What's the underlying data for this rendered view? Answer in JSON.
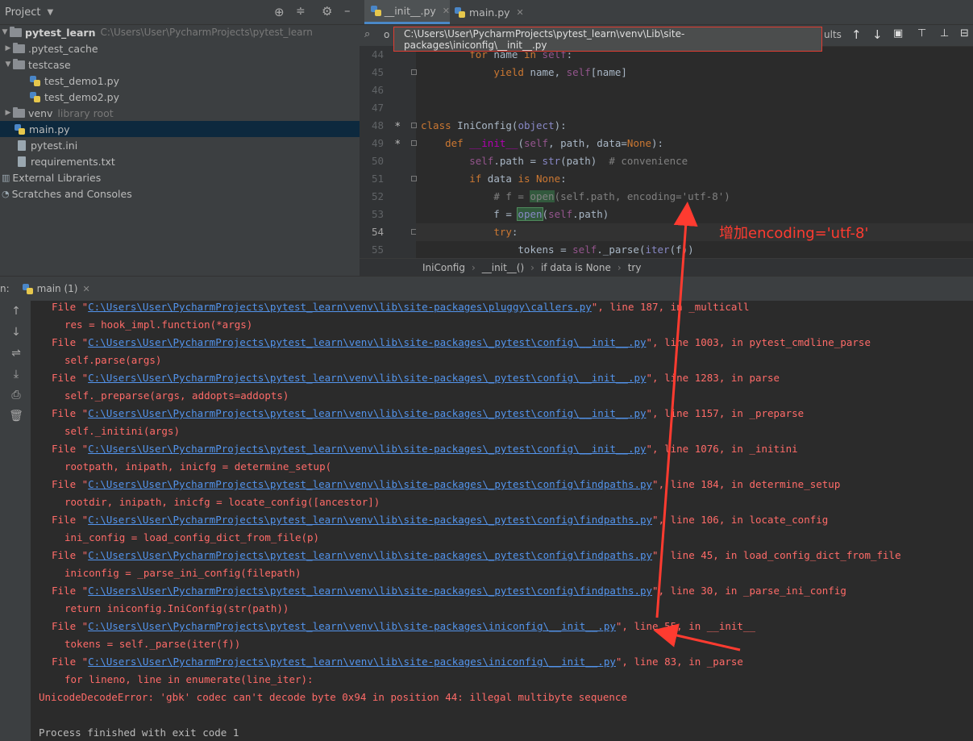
{
  "project": {
    "title": "Project",
    "tree": [
      {
        "label": "pytest_learn",
        "path": "C:\\Users\\User\\PycharmProjects\\pytest_learn"
      },
      {
        "label": ".pytest_cache"
      },
      {
        "label": "testcase"
      },
      {
        "label": "test_demo1.py"
      },
      {
        "label": "test_demo2.py"
      },
      {
        "label": "venv",
        "note": "library root"
      },
      {
        "label": "main.py"
      },
      {
        "label": "pytest.ini"
      },
      {
        "label": "requirements.txt"
      },
      {
        "label": "External Libraries"
      },
      {
        "label": "Scratches and Consoles"
      }
    ]
  },
  "editor": {
    "tabs": [
      {
        "label": "__init__.py"
      },
      {
        "label": "main.py"
      }
    ],
    "find_partial": "o",
    "find_results_partial": "ults",
    "tooltip": "C:\\Users\\User\\PycharmProjects\\pytest_learn\\venv\\Lib\\site-packages\\iniconfig\\__init__.py",
    "line_numbers": [
      "44",
      "45",
      "46",
      "47",
      "48",
      "49",
      "50",
      "51",
      "52",
      "53",
      "54",
      "55"
    ],
    "breadcrumb": [
      "IniConfig",
      "__init__()",
      "if data is None",
      "try"
    ],
    "annotation": "增加encoding='utf-8'"
  },
  "run": {
    "label": "n:",
    "tab": "main (1)",
    "console": [
      {
        "pre": "File \"",
        "link": "C:\\Users\\User\\PycharmProjects\\pytest_learn\\venv\\lib\\site-packages\\pluggy\\callers.py",
        "post": "\", line 187, in _multicall"
      },
      {
        "text": "res = hook_impl.function(*args)"
      },
      {
        "pre": "File \"",
        "link": "C:\\Users\\User\\PycharmProjects\\pytest_learn\\venv\\lib\\site-packages\\_pytest\\config\\__init__.py",
        "post": "\", line 1003, in pytest_cmdline_parse"
      },
      {
        "text": "self.parse(args)"
      },
      {
        "pre": "File \"",
        "link": "C:\\Users\\User\\PycharmProjects\\pytest_learn\\venv\\lib\\site-packages\\_pytest\\config\\__init__.py",
        "post": "\", line 1283, in parse"
      },
      {
        "text": "self._preparse(args, addopts=addopts)"
      },
      {
        "pre": "File \"",
        "link": "C:\\Users\\User\\PycharmProjects\\pytest_learn\\venv\\lib\\site-packages\\_pytest\\config\\__init__.py",
        "post": "\", line 1157, in _preparse"
      },
      {
        "text": "self._initini(args)"
      },
      {
        "pre": "File \"",
        "link": "C:\\Users\\User\\PycharmProjects\\pytest_learn\\venv\\lib\\site-packages\\_pytest\\config\\__init__.py",
        "post": "\", line 1076, in _initini"
      },
      {
        "text": "rootpath, inipath, inicfg = determine_setup("
      },
      {
        "pre": "File \"",
        "link": "C:\\Users\\User\\PycharmProjects\\pytest_learn\\venv\\lib\\site-packages\\_pytest\\config\\findpaths.py",
        "post": "\", line 184, in determine_setup"
      },
      {
        "text": "rootdir, inipath, inicfg = locate_config([ancestor])"
      },
      {
        "pre": "File \"",
        "link": "C:\\Users\\User\\PycharmProjects\\pytest_learn\\venv\\lib\\site-packages\\_pytest\\config\\findpaths.py",
        "post": "\", line 106, in locate_config"
      },
      {
        "text": "ini_config = load_config_dict_from_file(p)"
      },
      {
        "pre": "File \"",
        "link": "C:\\Users\\User\\PycharmProjects\\pytest_learn\\venv\\lib\\site-packages\\_pytest\\config\\findpaths.py",
        "post": "\", line 45, in load_config_dict_from_file"
      },
      {
        "text": "iniconfig = _parse_ini_config(filepath)"
      },
      {
        "pre": "File \"",
        "link": "C:\\Users\\User\\PycharmProjects\\pytest_learn\\venv\\lib\\site-packages\\_pytest\\config\\findpaths.py",
        "post": "\", line 30, in _parse_ini_config"
      },
      {
        "text": "return iniconfig.IniConfig(str(path))"
      },
      {
        "pre": "File \"",
        "link": "C:\\Users\\User\\PycharmProjects\\pytest_learn\\venv\\lib\\site-packages\\iniconfig\\__init__.py",
        "post": "\", line 55, in __init__"
      },
      {
        "text": "tokens = self._parse(iter(f))"
      },
      {
        "pre": "File \"",
        "link": "C:\\Users\\User\\PycharmProjects\\pytest_learn\\venv\\lib\\site-packages\\iniconfig\\__init__.py",
        "post": "\", line 83, in _parse"
      },
      {
        "text": "for lineno, line in enumerate(line_iter):"
      }
    ],
    "error": "UnicodeDecodeError: 'gbk' codec can't decode byte 0x94 in position 44: illegal multibyte sequence",
    "finished": "Process finished with exit code 1"
  },
  "colors": {
    "error": "#ff6b68",
    "link": "#5394ec",
    "annotation": "#ff3b30",
    "selection": "#0d293e"
  }
}
